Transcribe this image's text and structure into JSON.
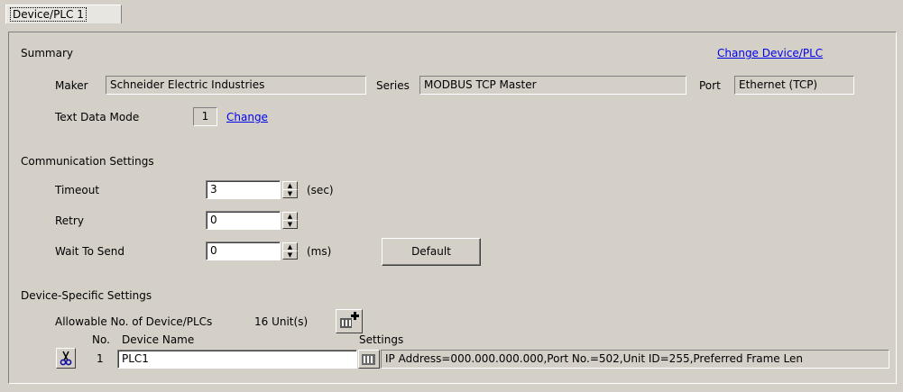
{
  "tab": {
    "label": "Device/PLC 1"
  },
  "summary": {
    "heading": "Summary",
    "change_device_link": "Change Device/PLC",
    "maker_label": "Maker",
    "maker_value": "Schneider Electric Industries",
    "series_label": "Series",
    "series_value": "MODBUS TCP Master",
    "port_label": "Port",
    "port_value": "Ethernet (TCP)",
    "text_mode_label": "Text Data Mode",
    "text_mode_value": "1",
    "text_mode_change": "Change"
  },
  "comm": {
    "heading": "Communication Settings",
    "timeout_label": "Timeout",
    "timeout_value": "3",
    "timeout_unit": "(sec)",
    "retry_label": "Retry",
    "retry_value": "0",
    "wait_label": "Wait To Send",
    "wait_value": "0",
    "wait_unit": "(ms)",
    "default_button": "Default"
  },
  "device": {
    "heading": "Device-Specific Settings",
    "allowable_label": "Allowable No. of Device/PLCs",
    "allowable_value": "16 Unit(s)",
    "col_no": "No.",
    "col_name": "Device Name",
    "col_settings": "Settings",
    "rows": [
      {
        "no": "1",
        "name": "PLC1",
        "settings": "IP Address=000.000.000.000,Port No.=502,Unit ID=255,Preferred Frame Len"
      }
    ]
  },
  "colors": {
    "face": "#d4d0c8",
    "link": "#0000ee"
  }
}
